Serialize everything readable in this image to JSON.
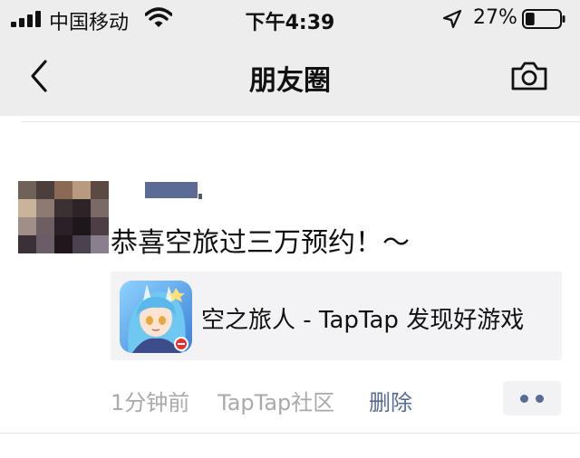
{
  "status_bar": {
    "carrier": "中国移动",
    "time": "下午4:39",
    "battery_percent": "27%",
    "battery_level": 0.27,
    "icons": [
      "signal-icon",
      "wifi-icon",
      "location-arrow-icon",
      "battery-icon"
    ]
  },
  "navbar": {
    "title": "朋友圈",
    "back_icon": "chevron-left-icon",
    "camera_icon": "camera-icon"
  },
  "post": {
    "avatar": "pixelated-avatar",
    "text": "恭喜空旅过三万预约！～",
    "link": {
      "title": "空之旅人 - TapTap 发现好游戏",
      "icon": "game-app-icon"
    },
    "time": "1分钟前",
    "source": "TapTap社区",
    "delete_label": "删除",
    "more_icon": "more-dots-icon"
  },
  "colors": {
    "header_bg": "#ededed",
    "link_blue": "#576b95",
    "meta_gray": "#aaaaaa",
    "card_bg": "#f3f3f5"
  }
}
